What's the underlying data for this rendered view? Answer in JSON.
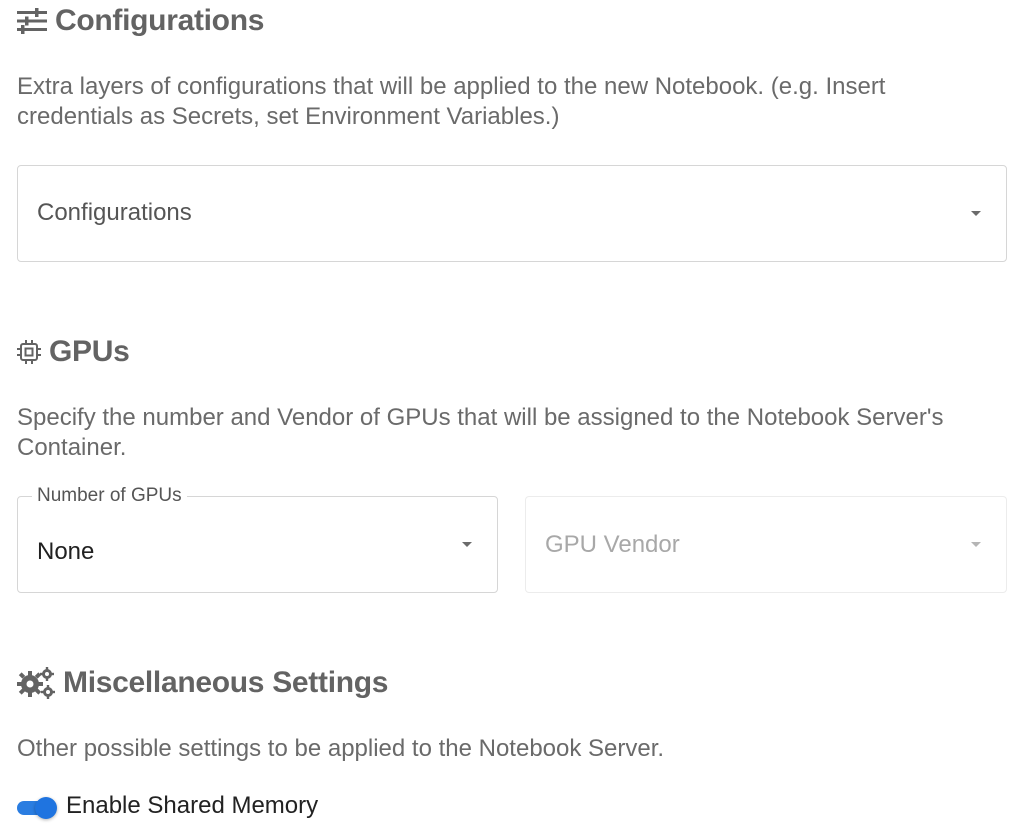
{
  "configurations": {
    "heading": "Configurations",
    "icon": "tune-sliders-icon",
    "description": "Extra layers of configurations that will be applied to the new Notebook. (e.g. Insert credentials as Secrets, set Environment Variables.)",
    "select_placeholder": "Configurations"
  },
  "gpus": {
    "heading": "GPUs",
    "icon": "chip-icon",
    "description": "Specify the number and Vendor of GPUs that will be assigned to the Notebook Server's Container.",
    "number_label": "Number of GPUs",
    "number_value": "None",
    "vendor_placeholder": "GPU Vendor"
  },
  "misc": {
    "heading": "Miscellaneous Settings",
    "icon": "gears-icon",
    "description": "Other possible settings to be applied to the Notebook Server.",
    "shared_memory_label": "Enable Shared Memory",
    "shared_memory_enabled": true
  },
  "colors": {
    "accent": "#1f74e0",
    "heading": "#636363",
    "text": "#6a6a6a"
  }
}
